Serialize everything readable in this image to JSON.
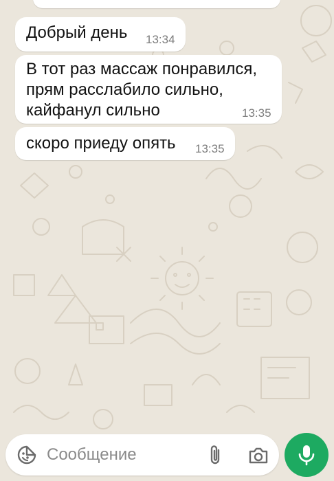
{
  "theme": {
    "chat_background": "#ebe6dc",
    "bubble_color": "#ffffff",
    "accent_green": "#1daa61",
    "time_color": "#7c7c7c"
  },
  "messages": [
    {
      "text": "Добрый день",
      "time": "13:34"
    },
    {
      "text": "В тот раз массаж понравился,\nпрям расслабило сильно,\nкайфанул сильно",
      "time": "13:35"
    },
    {
      "text": "скоро приеду опять",
      "time": "13:35"
    }
  ],
  "composer": {
    "placeholder": "Сообщение",
    "emoji_icon": "emoji-sticker-icon",
    "attach_icon": "paperclip-icon",
    "camera_icon": "camera-icon",
    "mic_icon": "microphone-icon"
  }
}
